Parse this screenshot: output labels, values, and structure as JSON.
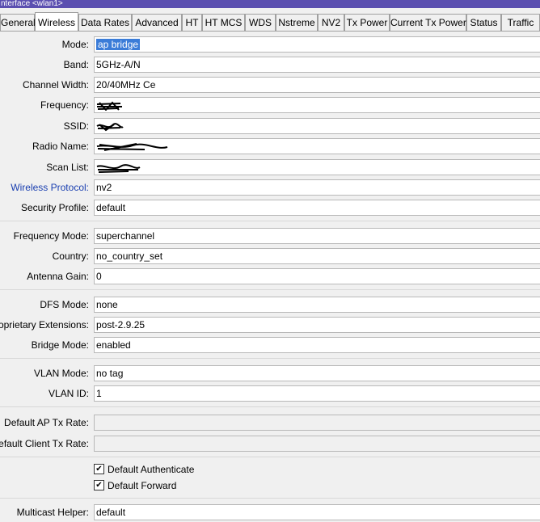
{
  "window": {
    "title": "nterface <wlan1>"
  },
  "tabs": [
    {
      "label": "General"
    },
    {
      "label": "Wireless"
    },
    {
      "label": "Data Rates"
    },
    {
      "label": "Advanced"
    },
    {
      "label": "HT"
    },
    {
      "label": "HT MCS"
    },
    {
      "label": "WDS"
    },
    {
      "label": "Nstreme"
    },
    {
      "label": "NV2"
    },
    {
      "label": "Tx Power"
    },
    {
      "label": "Current Tx Power"
    },
    {
      "label": "Status"
    },
    {
      "label": "Traffic"
    }
  ],
  "form": {
    "mode": {
      "label": "Mode:",
      "value": "ap bridge"
    },
    "band": {
      "label": "Band:",
      "value": "5GHz-A/N"
    },
    "channel_width": {
      "label": "Channel Width:",
      "value": "20/40MHz Ce"
    },
    "frequency": {
      "label": "Frequency:",
      "value": ""
    },
    "ssid": {
      "label": "SSID:",
      "value": ""
    },
    "radio_name": {
      "label": "Radio Name:",
      "value": ""
    },
    "scan_list": {
      "label": "Scan List:",
      "value": ""
    },
    "wireless_protocol": {
      "label": "Wireless Protocol:",
      "value": "nv2"
    },
    "security_profile": {
      "label": "Security Profile:",
      "value": "default"
    },
    "frequency_mode": {
      "label": "Frequency Mode:",
      "value": "superchannel"
    },
    "country": {
      "label": "Country:",
      "value": "no_country_set"
    },
    "antenna_gain": {
      "label": "Antenna Gain:",
      "value": "0"
    },
    "dfs_mode": {
      "label": "DFS Mode:",
      "value": "none"
    },
    "proprietary_extensions": {
      "label": "Proprietary Extensions:",
      "value": "post-2.9.25"
    },
    "bridge_mode": {
      "label": "Bridge Mode:",
      "value": "enabled"
    },
    "vlan_mode": {
      "label": "VLAN Mode:",
      "value": "no tag"
    },
    "vlan_id": {
      "label": "VLAN ID:",
      "value": "1"
    },
    "default_ap_tx_rate": {
      "label": "Default AP Tx Rate:",
      "value": ""
    },
    "default_client_tx_rate": {
      "label": "Default Client Tx Rate:",
      "value": ""
    },
    "default_authenticate": {
      "label": "Default Authenticate",
      "checked": true
    },
    "default_forward": {
      "label": "Default Forward",
      "checked": true
    },
    "multicast_helper": {
      "label": "Multicast Helper:",
      "value": "default"
    }
  },
  "icons": {
    "checkmark": "checkmark-icon"
  },
  "colors": {
    "titlebar": "#5b4fb0",
    "selection": "#3a7cd8",
    "link_label": "#1a3fb0"
  }
}
